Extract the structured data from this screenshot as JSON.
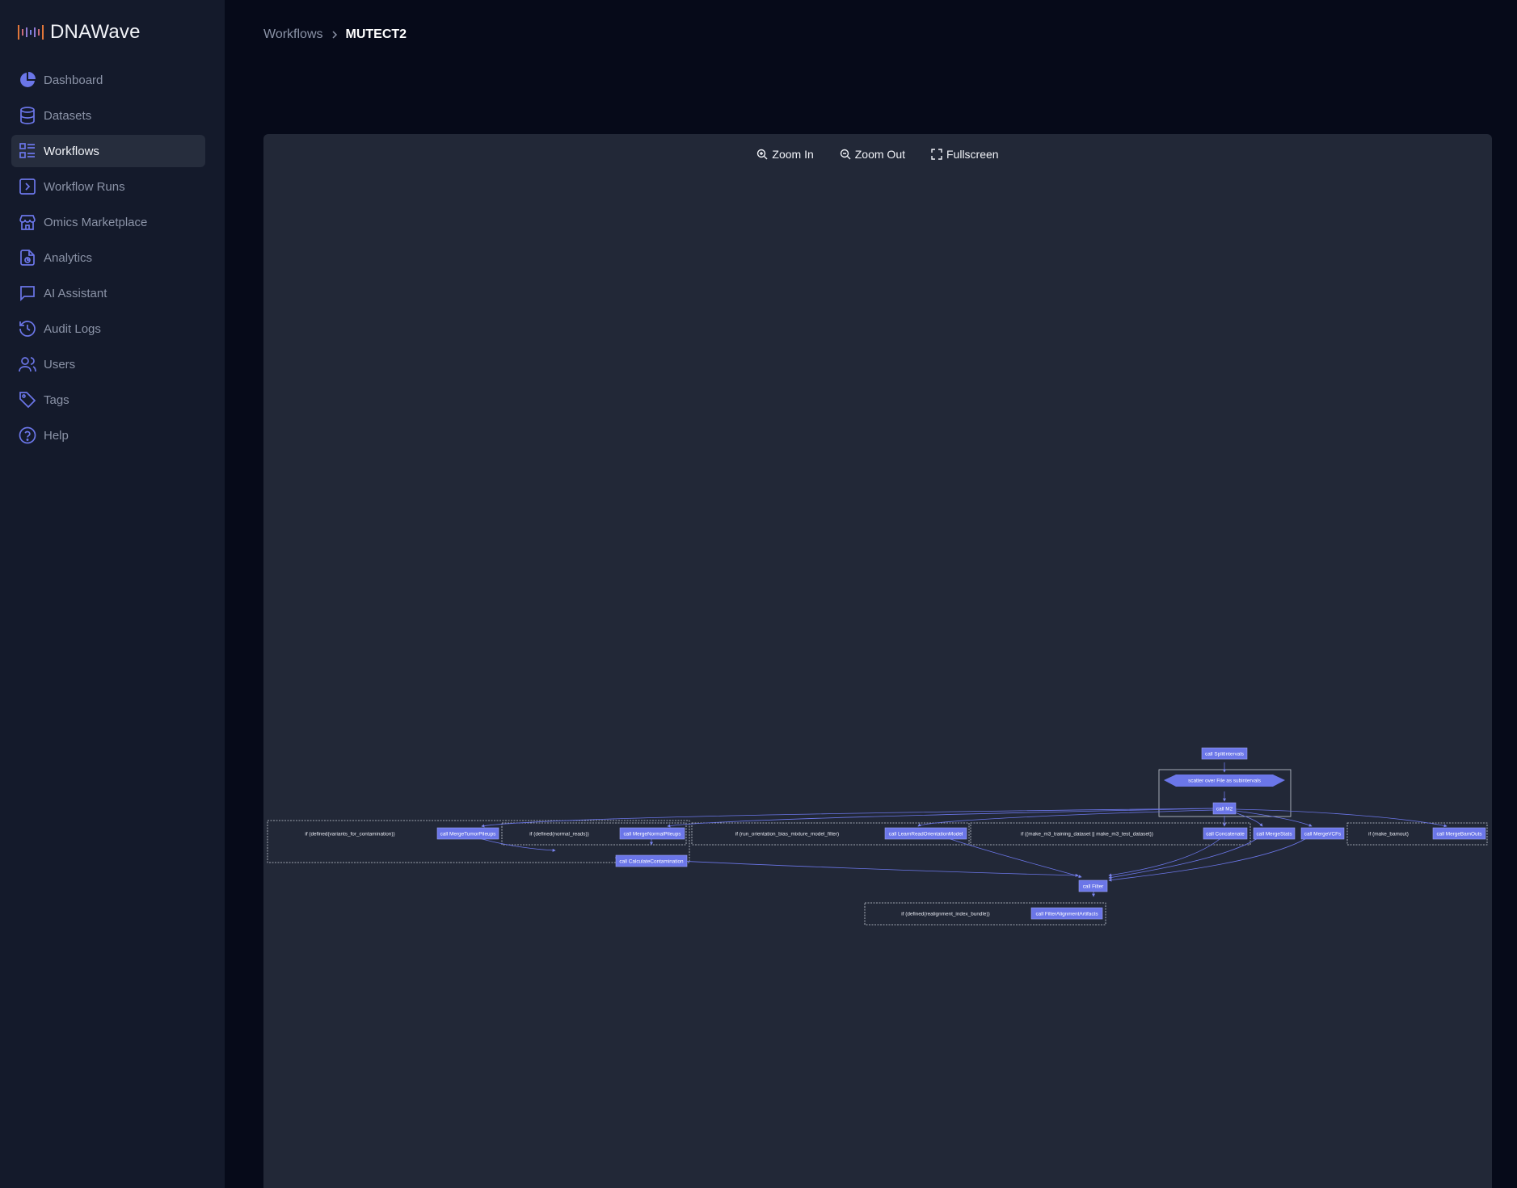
{
  "app": {
    "name": "DNAWave"
  },
  "sidebar": {
    "items": [
      {
        "label": "Dashboard",
        "icon": "pie-chart-icon",
        "active": false
      },
      {
        "label": "Datasets",
        "icon": "database-icon",
        "active": false
      },
      {
        "label": "Workflows",
        "icon": "workflow-list-icon",
        "active": true
      },
      {
        "label": "Workflow Runs",
        "icon": "terminal-icon",
        "active": false
      },
      {
        "label": "Omics Marketplace",
        "icon": "store-icon",
        "active": false
      },
      {
        "label": "Analytics",
        "icon": "analytics-icon",
        "active": false
      },
      {
        "label": "AI Assistant",
        "icon": "chat-icon",
        "active": false
      },
      {
        "label": "Audit Logs",
        "icon": "history-icon",
        "active": false
      },
      {
        "label": "Users",
        "icon": "users-icon",
        "active": false
      },
      {
        "label": "Tags",
        "icon": "tag-icon",
        "active": false
      },
      {
        "label": "Help",
        "icon": "help-icon",
        "active": false
      }
    ]
  },
  "breadcrumb": {
    "parent": "Workflows",
    "current": "MUTECT2"
  },
  "toolbar": {
    "zoom_in": "Zoom In",
    "zoom_out": "Zoom Out",
    "fullscreen": "Fullscreen"
  },
  "graph": {
    "nodes": {
      "split": "call SplitIntervals",
      "scatter": "scatter over File as subintervals",
      "m2": "call M2",
      "merge_tumor": "call MergeTumorPileups",
      "merge_normal": "call MergeNormalPileups",
      "calc_contam": "call CalculateContamination",
      "learn_orient": "call LearnReadOrientationModel",
      "concatenate": "call Concatenate",
      "merge_stats": "call MergeStats",
      "merge_vcfs": "call MergeVCFs",
      "merge_bam": "call MergeBamOuts",
      "filter": "call Filter",
      "filter_align": "call FilterAlignmentArtifacts"
    },
    "conditions": {
      "variants": "if (defined(variants_for_contamination))",
      "normal_reads": "if (defined(normal_reads))",
      "orientation": "if (run_orientation_bias_mixture_model_filter)",
      "m3": "if ((make_m3_training_dataset || make_m3_test_dataset))",
      "bamout": "if (make_bamout)",
      "realign": "if (defined(realignment_index_bundle))"
    }
  },
  "colors": {
    "accent": "#6b76e8",
    "sidebar_bg": "#141a2b",
    "page_bg": "#060a19",
    "panel_bg": "#222837"
  }
}
